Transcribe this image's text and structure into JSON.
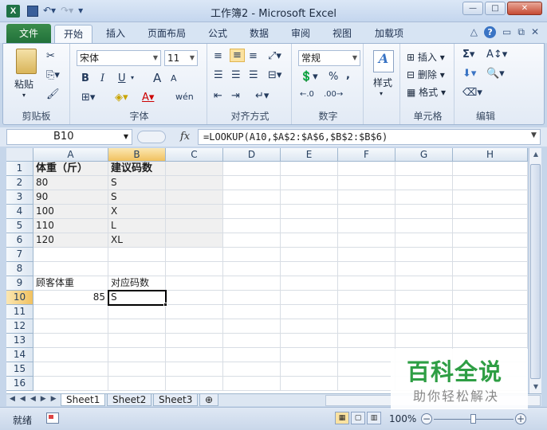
{
  "window": {
    "title": "工作簿2 - Microsoft Excel",
    "app_icon": "X",
    "controls": [
      "—",
      "□",
      "✕"
    ]
  },
  "ribbon_tabs": [
    "文件",
    "开始",
    "插入",
    "页面布局",
    "公式",
    "数据",
    "审阅",
    "视图",
    "加载项"
  ],
  "ribbon": {
    "clipboard": {
      "label": "剪贴板",
      "paste": "粘贴"
    },
    "font": {
      "label": "字体",
      "font_name": "宋体",
      "font_size": "11",
      "bold": "B",
      "italic": "I",
      "underline": "U",
      "grow": "A",
      "shrink": "A",
      "wen": "wén"
    },
    "alignment": {
      "label": "对齐方式"
    },
    "number": {
      "label": "数字",
      "format": "常规",
      "percent": "%",
      "comma": ","
    },
    "styles": {
      "label": "",
      "styles_btn": "样式"
    },
    "cells": {
      "label": "单元格",
      "insert": "插入",
      "delete": "删除",
      "format": "格式"
    },
    "editing": {
      "label": "编辑",
      "sum": "Σ"
    }
  },
  "formula_bar": {
    "name_box": "B10",
    "fx": "fx",
    "formula": "=LOOKUP(A10,$A$2:$A$6,$B$2:$B$6)"
  },
  "columns": [
    "A",
    "B",
    "C",
    "D",
    "E",
    "F",
    "G",
    "H"
  ],
  "rows": [
    "1",
    "2",
    "3",
    "4",
    "5",
    "6",
    "7",
    "8",
    "9",
    "10",
    "11",
    "12",
    "13",
    "14",
    "15",
    "16"
  ],
  "cells": {
    "A1": "体重（斤）",
    "B1": "建议码数",
    "A2": "80",
    "B2": "S",
    "A3": "90",
    "B3": "S",
    "A4": "100",
    "B4": "X",
    "A5": "110",
    "B5": "L",
    "A6": "120",
    "B6": "XL",
    "A9": "顾客体重",
    "B9": "对应码数",
    "A10": "85",
    "B10": "S"
  },
  "sheets": [
    "Sheet1",
    "Sheet2",
    "Sheet3"
  ],
  "status": {
    "ready": "就绪",
    "zoom": "100%"
  },
  "watermark": {
    "title": "百科全说",
    "subtitle": "助你轻松解决"
  }
}
